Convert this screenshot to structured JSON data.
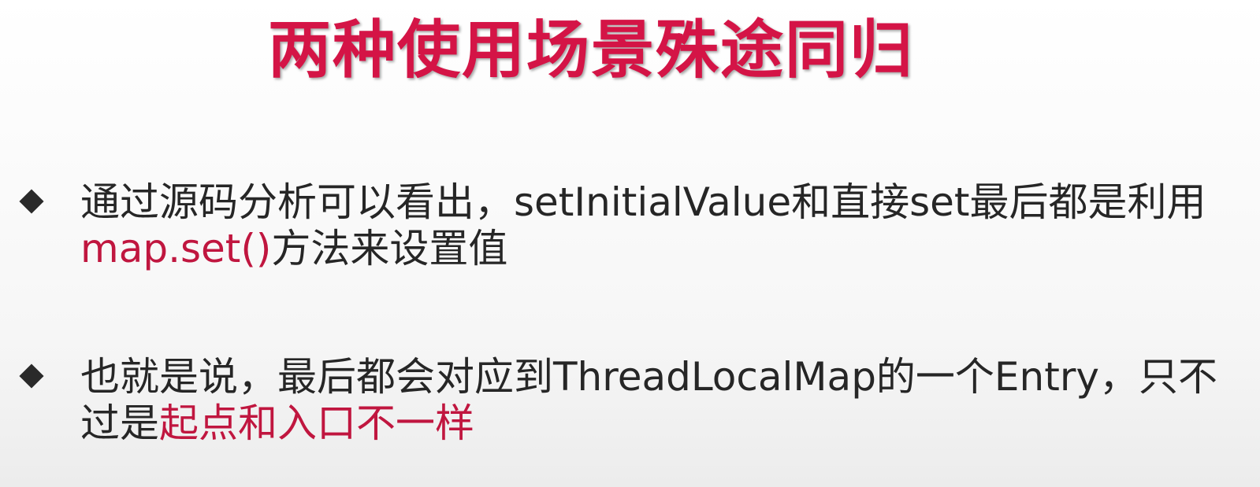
{
  "slide": {
    "title": "两种使用场景殊途同归",
    "bullets": [
      {
        "part1": "通过源码分析可以看出，setInitialValue和直接set最后都是利用",
        "highlight": "map.set()",
        "part2": "方法来设置值"
      },
      {
        "part1": "也就是说，最后都会对应到ThreadLocalMap的一个Entry，只不过是",
        "highlight": "起点和入口不一样",
        "part2": ""
      }
    ]
  },
  "colors": {
    "title": "#d41446",
    "highlight": "#c0163f",
    "body_text": "#262626",
    "bullet_marker": "#2a2a2a"
  },
  "icons": {
    "bullet_marker": "diamond-bullet-icon"
  }
}
